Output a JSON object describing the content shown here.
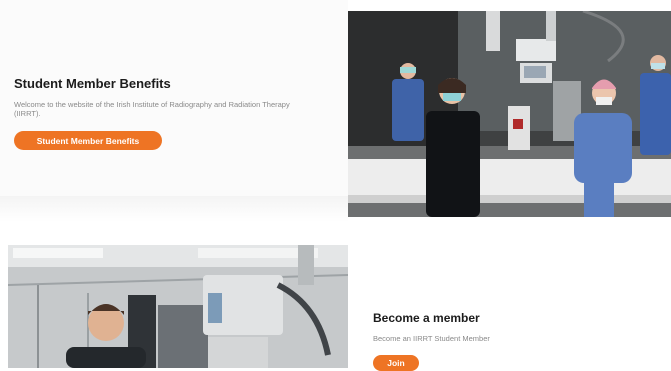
{
  "hero": {
    "title": "Student Member Benefits",
    "description": "Welcome to the website of the Irish Institute of Radiography and Radiation Therapy (IIRRT).",
    "button_label": "Student Member Benefits"
  },
  "membership": {
    "title": "Become a member",
    "description": "Become an IIRRT Student Member",
    "button_label": "Join"
  },
  "colors": {
    "accent": "#ee7424",
    "heading": "#1c1c1c",
    "body_text": "#8a8a8a"
  }
}
